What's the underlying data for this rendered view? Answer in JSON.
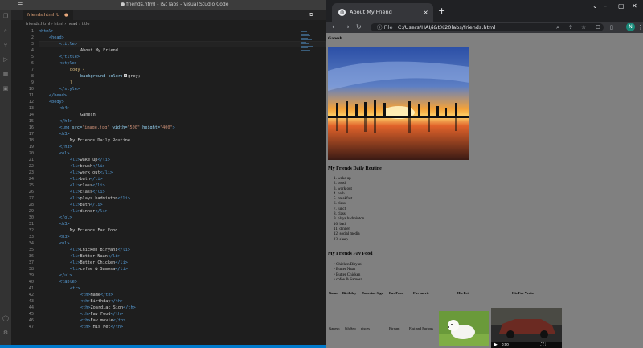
{
  "vscode": {
    "window_title": "● friends.html - i&t labs - Visual Studio Code",
    "tab": {
      "label": "friends.html",
      "status": "U"
    },
    "breadcrumbs": [
      "friends.html",
      "html",
      "head",
      "title"
    ],
    "line_numbers": [
      "1",
      "2",
      "3",
      "4",
      "5",
      "6",
      "7",
      "8",
      "9",
      "10",
      "11",
      "12",
      "13",
      "14",
      "15",
      "16",
      "17",
      "18",
      "19",
      "20",
      "21",
      "22",
      "23",
      "24",
      "25",
      "26",
      "27",
      "28",
      "29",
      "30",
      "31",
      "32",
      "33",
      "34",
      "35",
      "36",
      "37",
      "38",
      "39",
      "40",
      "41",
      "42",
      "43",
      "44",
      "45",
      "46",
      "47"
    ],
    "code_lines": [
      {
        "indent": 0,
        "parts": [
          [
            "tg",
            "<html>"
          ]
        ]
      },
      {
        "indent": 1,
        "parts": [
          [
            "tg",
            "<head>"
          ]
        ]
      },
      {
        "indent": 2,
        "parts": [
          [
            "tg",
            "<title>"
          ]
        ]
      },
      {
        "indent": 4,
        "parts": [
          [
            "tx",
            "About My Friend"
          ]
        ]
      },
      {
        "indent": 2,
        "parts": [
          [
            "tg",
            "</title>"
          ]
        ]
      },
      {
        "indent": 2,
        "parts": [
          [
            "tg",
            "<style>"
          ]
        ]
      },
      {
        "indent": 3,
        "parts": [
          [
            "cs",
            "body {"
          ]
        ]
      },
      {
        "indent": 4,
        "parts": [
          [
            "pr",
            "background-color:"
          ],
          [
            "sw",
            ""
          ],
          [
            "tx",
            "grey;"
          ]
        ]
      },
      {
        "indent": 3,
        "parts": [
          [
            "cs",
            "}"
          ]
        ]
      },
      {
        "indent": 2,
        "parts": [
          [
            "tg",
            "</style>"
          ]
        ]
      },
      {
        "indent": 1,
        "parts": [
          [
            "tg",
            "</head>"
          ]
        ]
      },
      {
        "indent": 1,
        "parts": [
          [
            "tg",
            "<body>"
          ]
        ]
      },
      {
        "indent": 2,
        "parts": [
          [
            "tg",
            "<h4>"
          ]
        ]
      },
      {
        "indent": 4,
        "parts": [
          [
            "tx",
            "Ganesh"
          ]
        ]
      },
      {
        "indent": 2,
        "parts": [
          [
            "tg",
            "</h4>"
          ]
        ]
      },
      {
        "indent": 2,
        "parts": [
          [
            "tg",
            "<img "
          ],
          [
            "at",
            "src="
          ],
          [
            "st",
            "\"image.jpg\""
          ],
          [
            "at",
            " width="
          ],
          [
            "st",
            "\"500\""
          ],
          [
            "at",
            " height="
          ],
          [
            "st",
            "\"400\""
          ],
          [
            "tg",
            ">"
          ]
        ]
      },
      {
        "indent": 2,
        "parts": [
          [
            "tg",
            "<h3>"
          ]
        ]
      },
      {
        "indent": 3,
        "parts": [
          [
            "tx",
            "My Friends Daily Routine"
          ]
        ]
      },
      {
        "indent": 2,
        "parts": [
          [
            "tg",
            "</h3>"
          ]
        ]
      },
      {
        "indent": 2,
        "parts": [
          [
            "tg",
            "<ol>"
          ]
        ]
      },
      {
        "indent": 3,
        "parts": [
          [
            "tg",
            "<li>"
          ],
          [
            "tx",
            "wake up"
          ],
          [
            "tg",
            "</li>"
          ]
        ]
      },
      {
        "indent": 3,
        "parts": [
          [
            "tg",
            "<li>"
          ],
          [
            "tx",
            "brush"
          ],
          [
            "tg",
            "</li>"
          ]
        ]
      },
      {
        "indent": 3,
        "parts": [
          [
            "tg",
            "<li>"
          ],
          [
            "tx",
            "work out"
          ],
          [
            "tg",
            "</li>"
          ]
        ]
      },
      {
        "indent": 3,
        "parts": [
          [
            "tg",
            "<li>"
          ],
          [
            "tx",
            "bath"
          ],
          [
            "tg",
            "</li>"
          ]
        ]
      },
      {
        "indent": 3,
        "parts": [
          [
            "tg",
            "<li>"
          ],
          [
            "tx",
            "class"
          ],
          [
            "tg",
            "</li>"
          ]
        ]
      },
      {
        "indent": 3,
        "parts": [
          [
            "tg",
            "<li>"
          ],
          [
            "tx",
            "class"
          ],
          [
            "tg",
            "</li>"
          ]
        ]
      },
      {
        "indent": 3,
        "parts": [
          [
            "tg",
            "<li>"
          ],
          [
            "tx",
            "plays badminton"
          ],
          [
            "tg",
            "</li>"
          ]
        ]
      },
      {
        "indent": 3,
        "parts": [
          [
            "tg",
            "<li>"
          ],
          [
            "tx",
            "bath"
          ],
          [
            "tg",
            "</li>"
          ]
        ]
      },
      {
        "indent": 3,
        "parts": [
          [
            "tg",
            "<li>"
          ],
          [
            "tx",
            "dinner"
          ],
          [
            "tg",
            "</li>"
          ]
        ]
      },
      {
        "indent": 2,
        "parts": [
          [
            "tg",
            "</ol>"
          ]
        ]
      },
      {
        "indent": 2,
        "parts": [
          [
            "tg",
            "<h3>"
          ]
        ]
      },
      {
        "indent": 3,
        "parts": [
          [
            "tx",
            "My Friends Fav Food"
          ]
        ]
      },
      {
        "indent": 2,
        "parts": [
          [
            "tg",
            "<h3>"
          ]
        ]
      },
      {
        "indent": 2,
        "parts": [
          [
            "tg",
            "<ul>"
          ]
        ]
      },
      {
        "indent": 3,
        "parts": [
          [
            "tg",
            "<li>"
          ],
          [
            "tx",
            "Chicken Biryani"
          ],
          [
            "tg",
            "</li>"
          ]
        ]
      },
      {
        "indent": 3,
        "parts": [
          [
            "tg",
            "<li>"
          ],
          [
            "tx",
            "Butter Naan"
          ],
          [
            "tg",
            "</li>"
          ]
        ]
      },
      {
        "indent": 3,
        "parts": [
          [
            "tg",
            "<li>"
          ],
          [
            "tx",
            "Butter Chicken"
          ],
          [
            "tg",
            "</li>"
          ]
        ]
      },
      {
        "indent": 3,
        "parts": [
          [
            "tg",
            "<li>"
          ],
          [
            "tx",
            "cofee & Samosa"
          ],
          [
            "tg",
            "</li>"
          ]
        ]
      },
      {
        "indent": 2,
        "parts": [
          [
            "tg",
            "</ul>"
          ]
        ]
      },
      {
        "indent": 2,
        "parts": [
          [
            "tg",
            "<table>"
          ]
        ]
      },
      {
        "indent": 3,
        "parts": [
          [
            "tg",
            "<tr>"
          ]
        ]
      },
      {
        "indent": 4,
        "parts": [
          [
            "tg",
            "<th>"
          ],
          [
            "tx",
            "Name"
          ],
          [
            "tg",
            "</th>"
          ]
        ]
      },
      {
        "indent": 4,
        "parts": [
          [
            "tg",
            "<th>"
          ],
          [
            "tx",
            "Birthday"
          ],
          [
            "tg",
            "</th>"
          ]
        ]
      },
      {
        "indent": 4,
        "parts": [
          [
            "tg",
            "<th>"
          ],
          [
            "tx",
            "Zoardiac Sign"
          ],
          [
            "tg",
            "</th>"
          ]
        ]
      },
      {
        "indent": 4,
        "parts": [
          [
            "tg",
            "<th>"
          ],
          [
            "tx",
            "Fav Food"
          ],
          [
            "tg",
            "</th>"
          ]
        ]
      },
      {
        "indent": 4,
        "parts": [
          [
            "tg",
            "<th>"
          ],
          [
            "tx",
            "Fav movie"
          ],
          [
            "tg",
            "</th>"
          ]
        ]
      },
      {
        "indent": 4,
        "parts": [
          [
            "tg",
            "<th>"
          ],
          [
            "tx",
            " His Pet"
          ],
          [
            "tg",
            "</th>"
          ]
        ]
      }
    ]
  },
  "chrome": {
    "tab_title": "About My Friend",
    "url_label": "File",
    "url": "C:/Users/HAI/i&t%20labs/friends.html",
    "avatar_letter": "N"
  },
  "page": {
    "heading": "Ganesh",
    "routine_title": "My Friends Daily Routine",
    "routine": [
      "wake up",
      "brush",
      "work out",
      "bath",
      "breakfast",
      "class",
      "lunch",
      "class",
      "plays badminton",
      "bath",
      "dinner",
      "social media",
      "sleep"
    ],
    "food_title": "My Friends Fav Food",
    "foods": [
      "Chicken Biryani",
      "Butter Naan",
      "Butter Chicken",
      "cofee & Samosa"
    ],
    "table_headers": [
      "Name",
      "Birthday",
      "Zoardiac Sign",
      "Fav Food",
      "Fav movie",
      "His Pet",
      "His Fav Vedio"
    ],
    "table_row": [
      "Ganesh",
      "8th Sep",
      "pisces",
      "Biryani",
      "Fast and Furious"
    ],
    "video_time": "0:00"
  }
}
